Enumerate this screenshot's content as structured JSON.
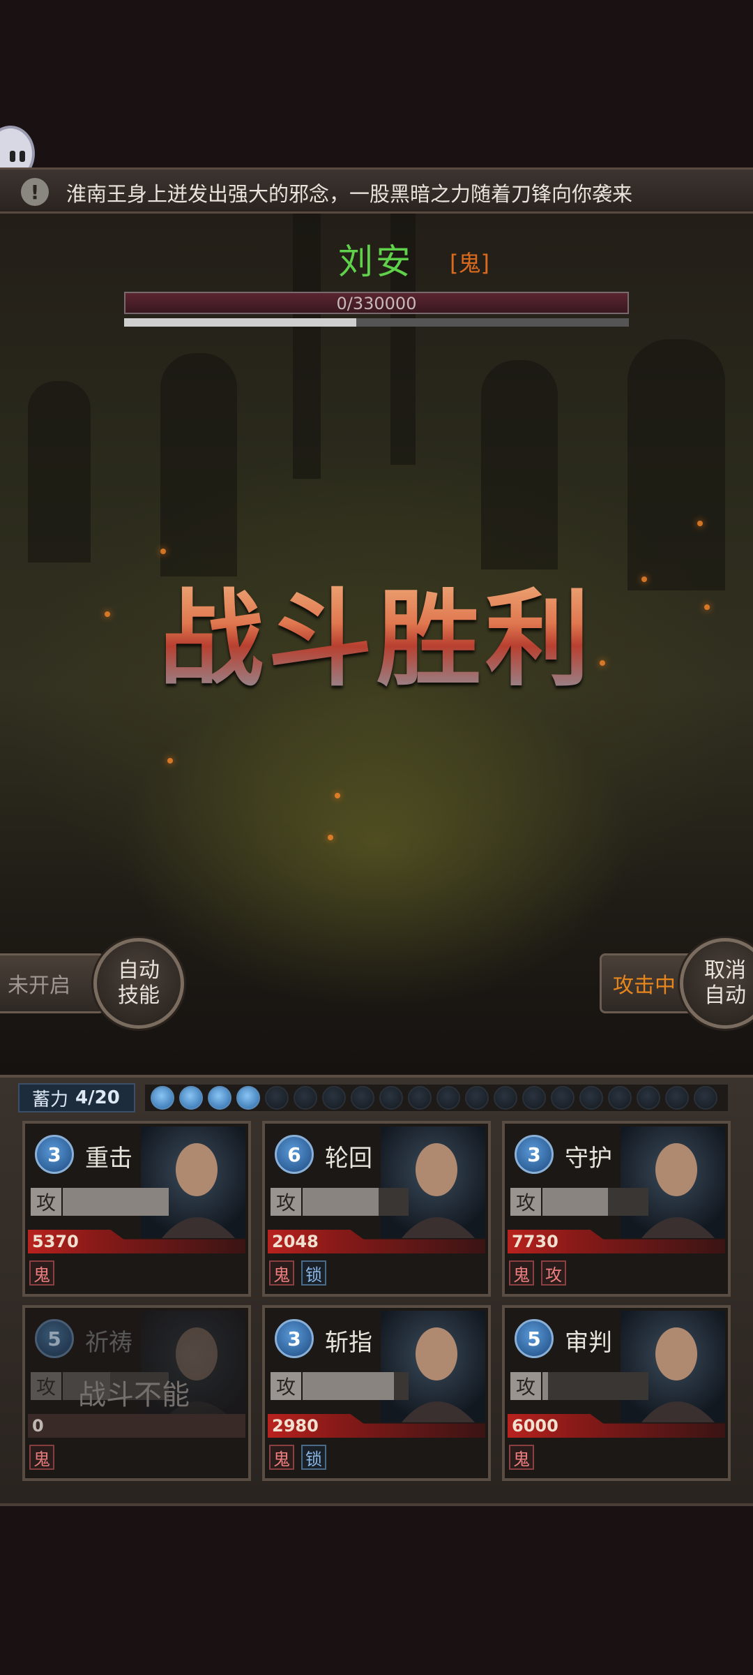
{
  "notice": {
    "text": "淮南王身上迸发出强大的邪念，一股黑暗之力随着刀锋向你袭来"
  },
  "boss": {
    "name": "刘安",
    "tag": "[鬼]",
    "hp_text": "0/330000",
    "sub_progress": 0.46
  },
  "result": {
    "text": "战斗胜利"
  },
  "controls": {
    "left_status": "未开启",
    "auto_skill_label_1": "自动",
    "auto_skill_label_2": "技能",
    "right_status": "攻击中",
    "cancel_auto_label_1": "取消",
    "cancel_auto_label_2": "自动"
  },
  "charge": {
    "label": "蓄力",
    "value": "4/20",
    "filled": 4,
    "total": 20
  },
  "cards": [
    {
      "level": "3",
      "skill": "重击",
      "atk_label": "攻",
      "atk_fill": 1.0,
      "power": "5370",
      "tags": [
        {
          "t": "鬼",
          "c": "red"
        }
      ],
      "dim": false,
      "disabled": ""
    },
    {
      "level": "6",
      "skill": "轮回",
      "atk_label": "攻",
      "atk_fill": 0.72,
      "power": "2048",
      "tags": [
        {
          "t": "鬼",
          "c": "red"
        },
        {
          "t": "锁",
          "c": "blue"
        }
      ],
      "dim": false,
      "disabled": ""
    },
    {
      "level": "3",
      "skill": "守护",
      "atk_label": "攻",
      "atk_fill": 0.62,
      "power": "7730",
      "tags": [
        {
          "t": "鬼",
          "c": "red"
        },
        {
          "t": "攻",
          "c": "red"
        }
      ],
      "dim": false,
      "disabled": ""
    },
    {
      "level": "5",
      "skill": "祈祷",
      "atk_label": "攻",
      "atk_fill": 0.45,
      "power": "0",
      "tags": [
        {
          "t": "鬼",
          "c": "red"
        }
      ],
      "dim": true,
      "disabled": "战斗不能"
    },
    {
      "level": "3",
      "skill": "斩指",
      "atk_label": "攻",
      "atk_fill": 0.86,
      "power": "2980",
      "tags": [
        {
          "t": "鬼",
          "c": "red"
        },
        {
          "t": "锁",
          "c": "blue"
        }
      ],
      "dim": false,
      "disabled": ""
    },
    {
      "level": "5",
      "skill": "审判",
      "atk_label": "攻",
      "atk_fill": 0.05,
      "power": "6000",
      "tags": [
        {
          "t": "鬼",
          "c": "red"
        }
      ],
      "dim": false,
      "disabled": ""
    }
  ],
  "colors": {
    "boss_name": "#5fd14a",
    "boss_tag": "#d96a1e",
    "attacking": "#e8861e"
  }
}
